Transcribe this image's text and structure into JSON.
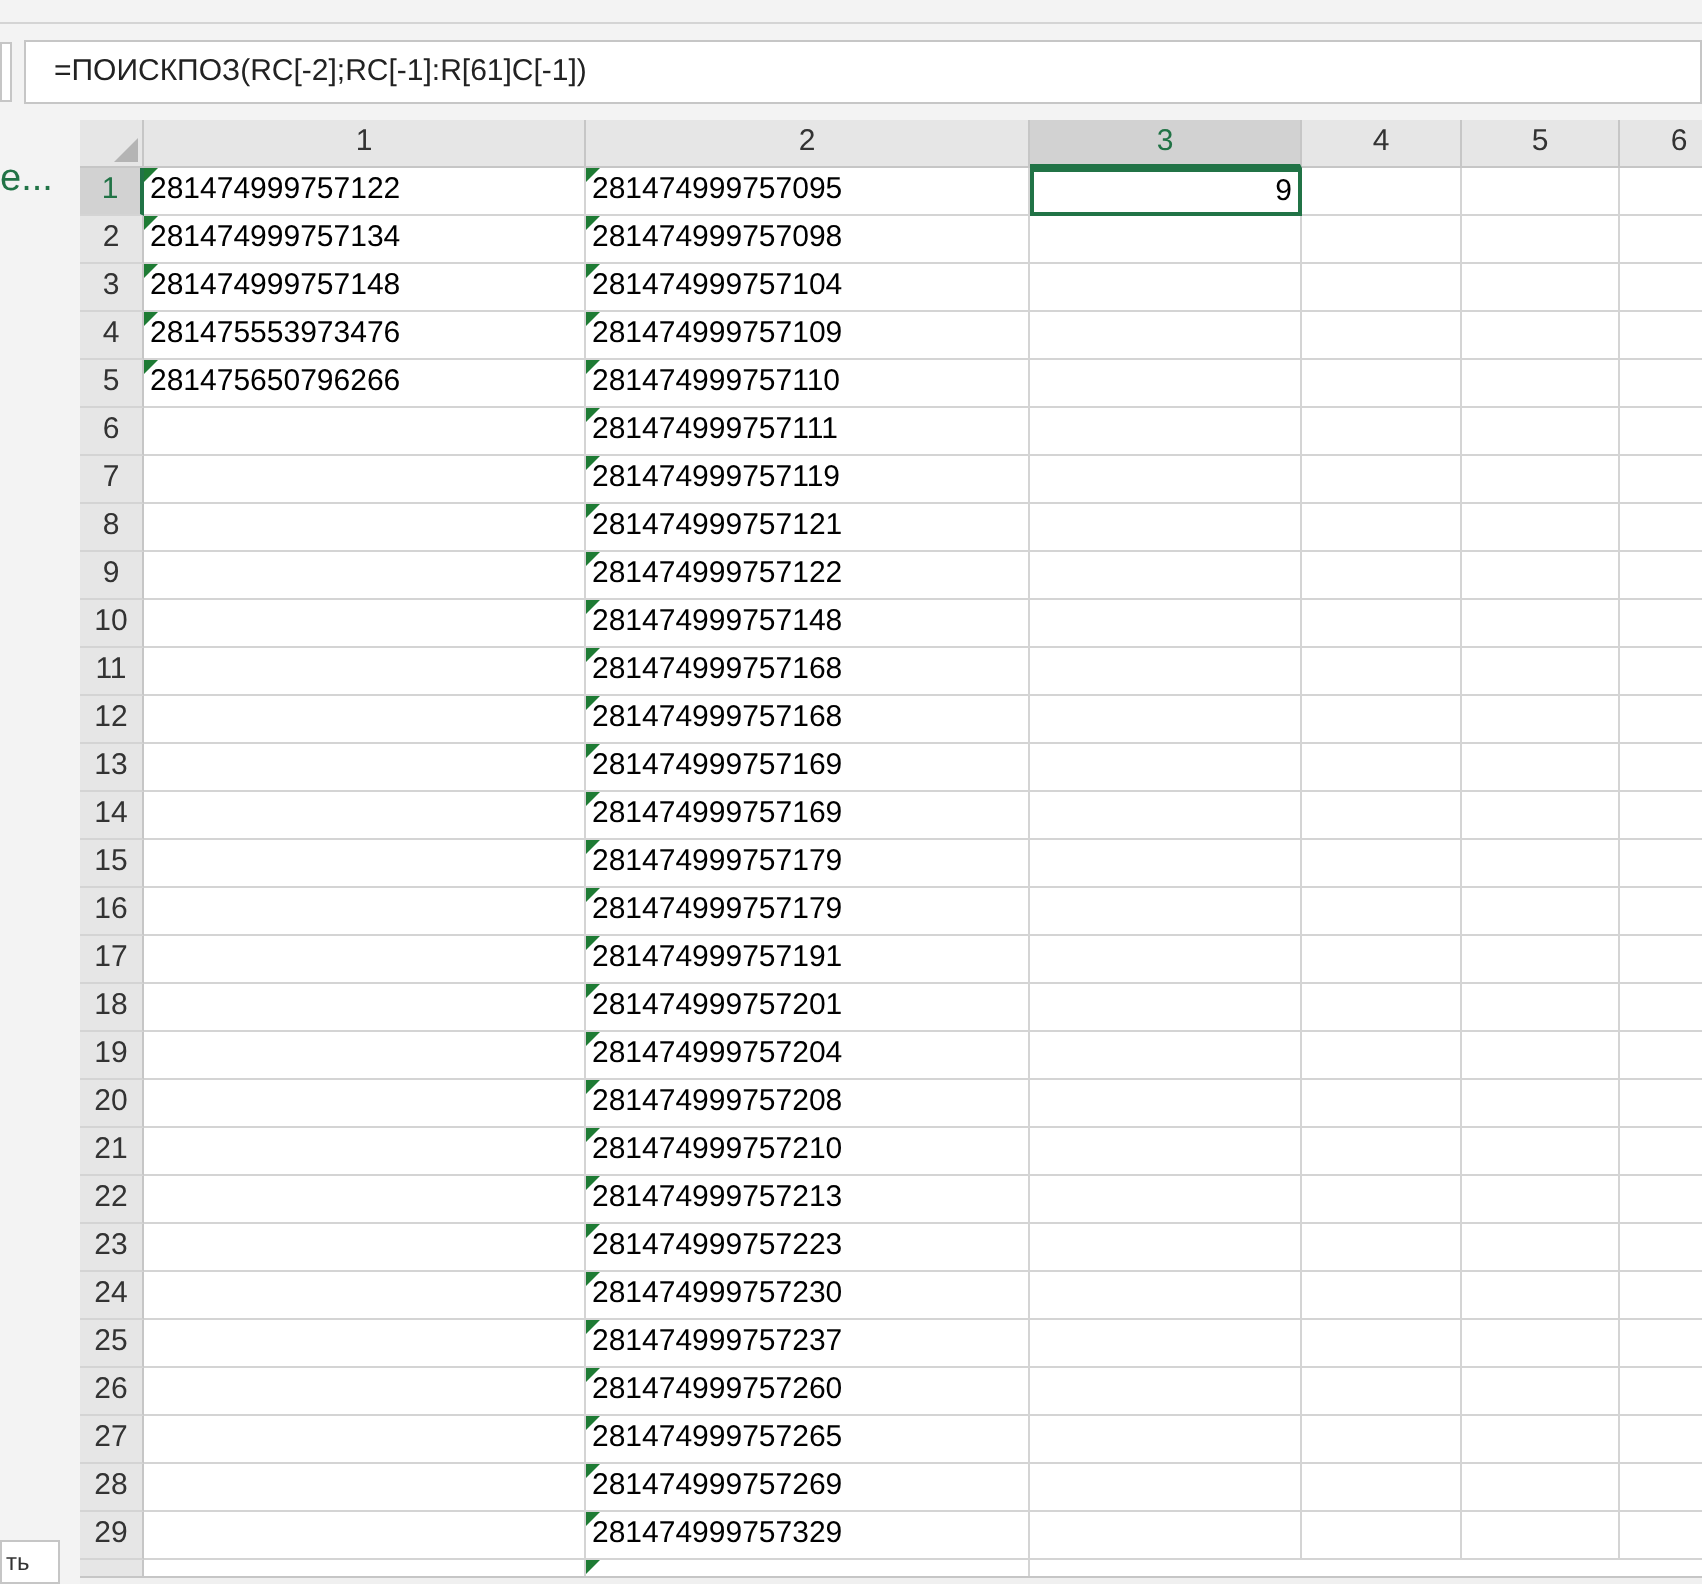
{
  "side_panel": {
    "link_fragment": "е...",
    "tab_fragment": "ть"
  },
  "formula_bar": {
    "formula": "=ПОИСКПОЗ(RC[-2];RC[-1]:R[61]C[-1])"
  },
  "columns": [
    {
      "label": "1",
      "selected": false
    },
    {
      "label": "2",
      "selected": false
    },
    {
      "label": "3",
      "selected": true
    },
    {
      "label": "4",
      "selected": false
    },
    {
      "label": "5",
      "selected": false
    },
    {
      "label": "6",
      "selected": false
    }
  ],
  "rows": [
    {
      "label": "1",
      "selected": true,
      "cells": [
        {
          "text": "281474999757122",
          "flag": true
        },
        {
          "text": "281474999757095",
          "flag": true
        },
        {
          "text": "9",
          "flag": false,
          "selected": true,
          "kind": "number"
        }
      ]
    },
    {
      "label": "2",
      "selected": false,
      "cells": [
        {
          "text": "281474999757134",
          "flag": true
        },
        {
          "text": "281474999757098",
          "flag": true
        }
      ]
    },
    {
      "label": "3",
      "selected": false,
      "cells": [
        {
          "text": "281474999757148",
          "flag": true
        },
        {
          "text": "281474999757104",
          "flag": true
        }
      ]
    },
    {
      "label": "4",
      "selected": false,
      "cells": [
        {
          "text": "281475553973476",
          "flag": true
        },
        {
          "text": "281474999757109",
          "flag": true
        }
      ]
    },
    {
      "label": "5",
      "selected": false,
      "cells": [
        {
          "text": "281475650796266",
          "flag": true
        },
        {
          "text": "281474999757110",
          "flag": true
        }
      ]
    },
    {
      "label": "6",
      "selected": false,
      "cells": [
        {
          "flag": false
        },
        {
          "text": "281474999757111",
          "flag": true
        }
      ]
    },
    {
      "label": "7",
      "selected": false,
      "cells": [
        {
          "flag": false
        },
        {
          "text": "281474999757119",
          "flag": true
        }
      ]
    },
    {
      "label": "8",
      "selected": false,
      "cells": [
        {
          "flag": false
        },
        {
          "text": "281474999757121",
          "flag": true
        }
      ]
    },
    {
      "label": "9",
      "selected": false,
      "cells": [
        {
          "flag": false
        },
        {
          "text": "281474999757122",
          "flag": true
        }
      ]
    },
    {
      "label": "10",
      "selected": false,
      "cells": [
        {
          "flag": false
        },
        {
          "text": "281474999757148",
          "flag": true
        }
      ]
    },
    {
      "label": "11",
      "selected": false,
      "cells": [
        {
          "flag": false
        },
        {
          "text": "281474999757168",
          "flag": true
        }
      ]
    },
    {
      "label": "12",
      "selected": false,
      "cells": [
        {
          "flag": false
        },
        {
          "text": "281474999757168",
          "flag": true
        }
      ]
    },
    {
      "label": "13",
      "selected": false,
      "cells": [
        {
          "flag": false
        },
        {
          "text": "281474999757169",
          "flag": true
        }
      ]
    },
    {
      "label": "14",
      "selected": false,
      "cells": [
        {
          "flag": false
        },
        {
          "text": "281474999757169",
          "flag": true
        }
      ]
    },
    {
      "label": "15",
      "selected": false,
      "cells": [
        {
          "flag": false
        },
        {
          "text": "281474999757179",
          "flag": true
        }
      ]
    },
    {
      "label": "16",
      "selected": false,
      "cells": [
        {
          "flag": false
        },
        {
          "text": "281474999757179",
          "flag": true
        }
      ]
    },
    {
      "label": "17",
      "selected": false,
      "cells": [
        {
          "flag": false
        },
        {
          "text": "281474999757191",
          "flag": true
        }
      ]
    },
    {
      "label": "18",
      "selected": false,
      "cells": [
        {
          "flag": false
        },
        {
          "text": "281474999757201",
          "flag": true
        }
      ]
    },
    {
      "label": "19",
      "selected": false,
      "cells": [
        {
          "flag": false
        },
        {
          "text": "281474999757204",
          "flag": true
        }
      ]
    },
    {
      "label": "20",
      "selected": false,
      "cells": [
        {
          "flag": false
        },
        {
          "text": "281474999757208",
          "flag": true
        }
      ]
    },
    {
      "label": "21",
      "selected": false,
      "cells": [
        {
          "flag": false
        },
        {
          "text": "281474999757210",
          "flag": true
        }
      ]
    },
    {
      "label": "22",
      "selected": false,
      "cells": [
        {
          "flag": false
        },
        {
          "text": "281474999757213",
          "flag": true
        }
      ]
    },
    {
      "label": "23",
      "selected": false,
      "cells": [
        {
          "flag": false
        },
        {
          "text": "281474999757223",
          "flag": true
        }
      ]
    },
    {
      "label": "24",
      "selected": false,
      "cells": [
        {
          "flag": false
        },
        {
          "text": "281474999757230",
          "flag": true
        }
      ]
    },
    {
      "label": "25",
      "selected": false,
      "cells": [
        {
          "flag": false
        },
        {
          "text": "281474999757237",
          "flag": true
        }
      ]
    },
    {
      "label": "26",
      "selected": false,
      "cells": [
        {
          "flag": false
        },
        {
          "text": "281474999757260",
          "flag": true
        }
      ]
    },
    {
      "label": "27",
      "selected": false,
      "cells": [
        {
          "flag": false
        },
        {
          "text": "281474999757265",
          "flag": true
        }
      ]
    },
    {
      "label": "28",
      "selected": false,
      "cells": [
        {
          "flag": false
        },
        {
          "text": "281474999757269",
          "flag": true
        }
      ]
    },
    {
      "label": "29",
      "selected": false,
      "cells": [
        {
          "flag": false
        },
        {
          "text": "281474999757329",
          "flag": true
        }
      ]
    }
  ]
}
